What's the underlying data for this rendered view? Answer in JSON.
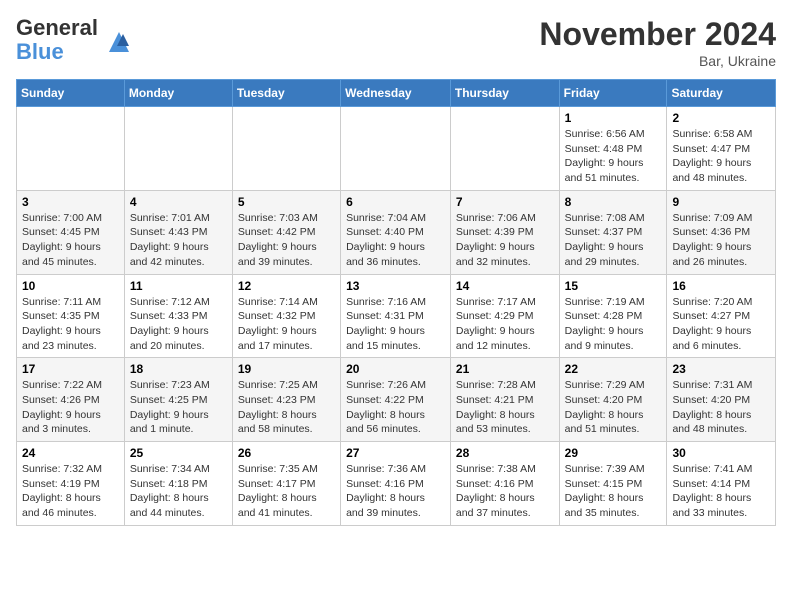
{
  "header": {
    "logo_general": "General",
    "logo_blue": "Blue",
    "month_title": "November 2024",
    "location": "Bar, Ukraine"
  },
  "weekdays": [
    "Sunday",
    "Monday",
    "Tuesday",
    "Wednesday",
    "Thursday",
    "Friday",
    "Saturday"
  ],
  "weeks": [
    [
      {
        "day": "",
        "info": ""
      },
      {
        "day": "",
        "info": ""
      },
      {
        "day": "",
        "info": ""
      },
      {
        "day": "",
        "info": ""
      },
      {
        "day": "",
        "info": ""
      },
      {
        "day": "1",
        "info": "Sunrise: 6:56 AM\nSunset: 4:48 PM\nDaylight: 9 hours and 51 minutes."
      },
      {
        "day": "2",
        "info": "Sunrise: 6:58 AM\nSunset: 4:47 PM\nDaylight: 9 hours and 48 minutes."
      }
    ],
    [
      {
        "day": "3",
        "info": "Sunrise: 7:00 AM\nSunset: 4:45 PM\nDaylight: 9 hours and 45 minutes."
      },
      {
        "day": "4",
        "info": "Sunrise: 7:01 AM\nSunset: 4:43 PM\nDaylight: 9 hours and 42 minutes."
      },
      {
        "day": "5",
        "info": "Sunrise: 7:03 AM\nSunset: 4:42 PM\nDaylight: 9 hours and 39 minutes."
      },
      {
        "day": "6",
        "info": "Sunrise: 7:04 AM\nSunset: 4:40 PM\nDaylight: 9 hours and 36 minutes."
      },
      {
        "day": "7",
        "info": "Sunrise: 7:06 AM\nSunset: 4:39 PM\nDaylight: 9 hours and 32 minutes."
      },
      {
        "day": "8",
        "info": "Sunrise: 7:08 AM\nSunset: 4:37 PM\nDaylight: 9 hours and 29 minutes."
      },
      {
        "day": "9",
        "info": "Sunrise: 7:09 AM\nSunset: 4:36 PM\nDaylight: 9 hours and 26 minutes."
      }
    ],
    [
      {
        "day": "10",
        "info": "Sunrise: 7:11 AM\nSunset: 4:35 PM\nDaylight: 9 hours and 23 minutes."
      },
      {
        "day": "11",
        "info": "Sunrise: 7:12 AM\nSunset: 4:33 PM\nDaylight: 9 hours and 20 minutes."
      },
      {
        "day": "12",
        "info": "Sunrise: 7:14 AM\nSunset: 4:32 PM\nDaylight: 9 hours and 17 minutes."
      },
      {
        "day": "13",
        "info": "Sunrise: 7:16 AM\nSunset: 4:31 PM\nDaylight: 9 hours and 15 minutes."
      },
      {
        "day": "14",
        "info": "Sunrise: 7:17 AM\nSunset: 4:29 PM\nDaylight: 9 hours and 12 minutes."
      },
      {
        "day": "15",
        "info": "Sunrise: 7:19 AM\nSunset: 4:28 PM\nDaylight: 9 hours and 9 minutes."
      },
      {
        "day": "16",
        "info": "Sunrise: 7:20 AM\nSunset: 4:27 PM\nDaylight: 9 hours and 6 minutes."
      }
    ],
    [
      {
        "day": "17",
        "info": "Sunrise: 7:22 AM\nSunset: 4:26 PM\nDaylight: 9 hours and 3 minutes."
      },
      {
        "day": "18",
        "info": "Sunrise: 7:23 AM\nSunset: 4:25 PM\nDaylight: 9 hours and 1 minute."
      },
      {
        "day": "19",
        "info": "Sunrise: 7:25 AM\nSunset: 4:23 PM\nDaylight: 8 hours and 58 minutes."
      },
      {
        "day": "20",
        "info": "Sunrise: 7:26 AM\nSunset: 4:22 PM\nDaylight: 8 hours and 56 minutes."
      },
      {
        "day": "21",
        "info": "Sunrise: 7:28 AM\nSunset: 4:21 PM\nDaylight: 8 hours and 53 minutes."
      },
      {
        "day": "22",
        "info": "Sunrise: 7:29 AM\nSunset: 4:20 PM\nDaylight: 8 hours and 51 minutes."
      },
      {
        "day": "23",
        "info": "Sunrise: 7:31 AM\nSunset: 4:20 PM\nDaylight: 8 hours and 48 minutes."
      }
    ],
    [
      {
        "day": "24",
        "info": "Sunrise: 7:32 AM\nSunset: 4:19 PM\nDaylight: 8 hours and 46 minutes."
      },
      {
        "day": "25",
        "info": "Sunrise: 7:34 AM\nSunset: 4:18 PM\nDaylight: 8 hours and 44 minutes."
      },
      {
        "day": "26",
        "info": "Sunrise: 7:35 AM\nSunset: 4:17 PM\nDaylight: 8 hours and 41 minutes."
      },
      {
        "day": "27",
        "info": "Sunrise: 7:36 AM\nSunset: 4:16 PM\nDaylight: 8 hours and 39 minutes."
      },
      {
        "day": "28",
        "info": "Sunrise: 7:38 AM\nSunset: 4:16 PM\nDaylight: 8 hours and 37 minutes."
      },
      {
        "day": "29",
        "info": "Sunrise: 7:39 AM\nSunset: 4:15 PM\nDaylight: 8 hours and 35 minutes."
      },
      {
        "day": "30",
        "info": "Sunrise: 7:41 AM\nSunset: 4:14 PM\nDaylight: 8 hours and 33 minutes."
      }
    ]
  ]
}
